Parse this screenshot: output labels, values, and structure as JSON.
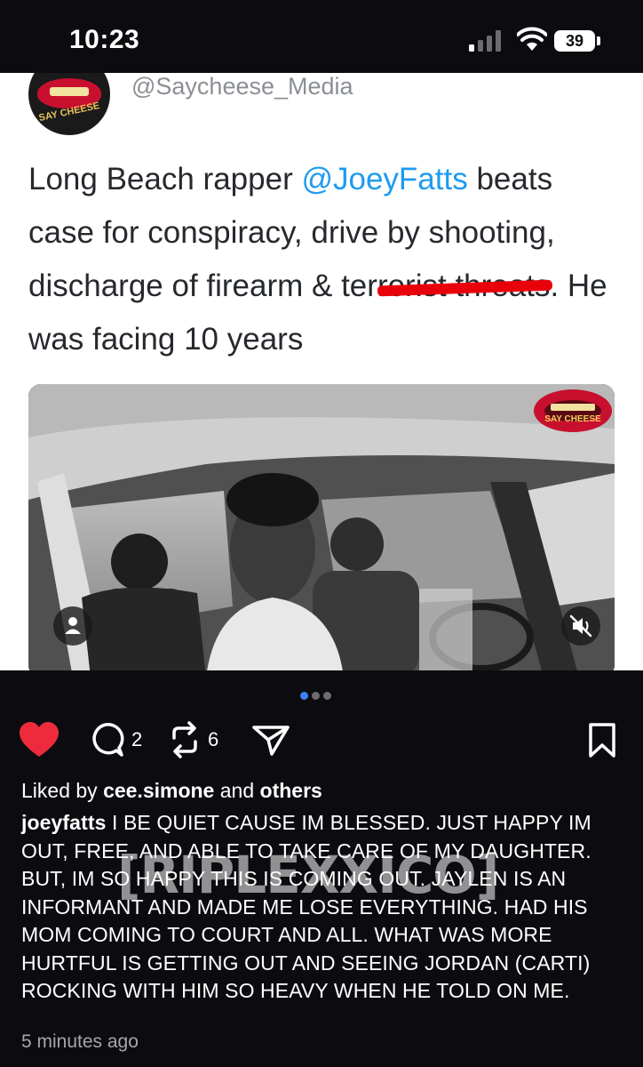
{
  "status_bar": {
    "time": "10:23",
    "battery": "39"
  },
  "tweet": {
    "handle": "@Saycheese_Media",
    "avatar_text": "SAY CHEESE",
    "text_part1": "Long Beach rapper ",
    "mention": "@JoeyFatts",
    "text_part2": " beats case for conspiracy, drive by shooting, discharge of firearm & ter",
    "redacted_text": "rorist threats",
    "text_part3": ". He was facing 10 years",
    "photo_logo_text": "SAY CHEESE"
  },
  "carousel": {
    "count": 3,
    "active_index": 0
  },
  "actions": {
    "comments": "2",
    "reposts": "6"
  },
  "likes": {
    "prefix": "Liked by ",
    "user": "cee.simone",
    "middle": " and ",
    "others": "others"
  },
  "caption": {
    "username": "joeyfatts",
    "text": " I BE QUIET CAUSE IM BLESSED. JUST HAPPY IM OUT, FREE, AND ABLE TO TAKE CARE OF MY DAUGHTER. BUT, IM SO HAPPY THIS IS COMING OUT. JAYLEN IS AN INFORMANT AND MADE ME LOSE EVERYTHING. HAD HIS MOM COMING TO COURT AND ALL. WHAT WAS MORE HURTFUL IS GETTING OUT AND SEEING JORDAN (CARTI) ROCKING WITH HIM SO HEAVY WHEN HE TOLD ON ME."
  },
  "watermark": "[RIPLEXXICO]",
  "timestamp": "5 minutes ago",
  "colors": {
    "heart": "#ee2b3c",
    "mention": "#1d9bf0",
    "redaction": "#e8000b",
    "active_dot": "#3b82f6"
  }
}
